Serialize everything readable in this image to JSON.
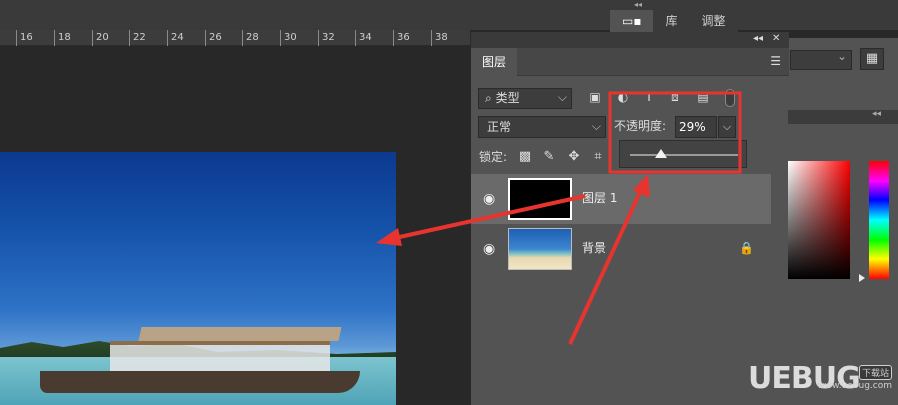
{
  "ruler": {
    "ticks": [
      "16",
      "18",
      "20",
      "22",
      "24",
      "26",
      "28",
      "30",
      "32",
      "34",
      "36",
      "38"
    ]
  },
  "top_tabs": [
    {
      "label": "▭▪",
      "active": true
    },
    {
      "label": "库",
      "active": false
    },
    {
      "label": "调整",
      "active": false
    }
  ],
  "right_panel": {
    "grid_icon": "▦"
  },
  "layers_panel": {
    "tab_label": "图层",
    "collapse_icon": "◂◂",
    "close_icon": "✕",
    "menu_icon": "☰",
    "filter": {
      "search_icon": "⌕",
      "label": "类型",
      "chevron": "⌵"
    },
    "filter_icons": [
      "▣",
      "◐",
      "T",
      "⧈",
      "▤"
    ],
    "blend_mode": "正常",
    "blend_chevron": "⌵",
    "opacity_label": "不透明度:",
    "opacity_value": "29%",
    "opacity_percent": 29,
    "opacity_dropdown_icon": "⌵",
    "lock_label": "锁定:",
    "lock_icons": [
      "▩",
      "✎",
      "✥",
      "⌗"
    ],
    "layers": [
      {
        "name": "图层 1",
        "visible": true,
        "selected": true,
        "thumbnail": "black",
        "locked": false
      },
      {
        "name": "背景",
        "visible": true,
        "selected": false,
        "thumbnail": "beach",
        "locked": true
      }
    ],
    "eye_icon": "◉",
    "lock_icon": "🔒"
  },
  "annotation_colors": {
    "arrow": "#e8342f",
    "highlight_box": "#e8342f"
  },
  "watermark": {
    "main": "UEBUG",
    "suffix": ".com",
    "cn_badge": "下载站",
    "sub": "www.uebug.com"
  }
}
